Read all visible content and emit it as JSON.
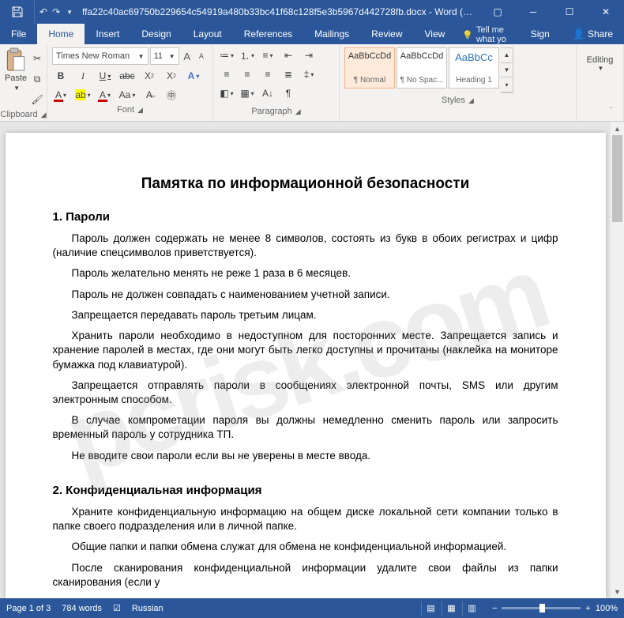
{
  "titlebar": {
    "filename": "ffa22c40ac69750b229654c54919a480b33bc41f68c128f5e3b5967d442728fb.docx - Word (Pro..."
  },
  "tabs": {
    "file": "File",
    "home": "Home",
    "insert": "Insert",
    "design": "Design",
    "layout": "Layout",
    "references": "References",
    "mailings": "Mailings",
    "review": "Review",
    "view": "View",
    "tell": "Tell me what yo",
    "signin": "Sign in",
    "share": "Share"
  },
  "ribbon": {
    "clipboard": {
      "paste": "Paste",
      "label": "Clipboard"
    },
    "font": {
      "name": "Times New Roman",
      "size": "11",
      "label": "Font"
    },
    "paragraph": {
      "label": "Paragraph"
    },
    "styles": {
      "label": "Styles",
      "items": [
        {
          "preview": "AaBbCcDd",
          "name": "¶ Normal"
        },
        {
          "preview": "AaBbCcDd",
          "name": "¶ No Spac..."
        },
        {
          "preview": "AaBbCc",
          "name": "Heading 1"
        }
      ]
    },
    "editing": {
      "label": "Editing"
    }
  },
  "document": {
    "title": "Памятка по информационной безопасности",
    "s1_head": "1. Пароли",
    "s1_p1": "Пароль должен содержать не менее 8 символов, состоять из букв в обоих регистрах и цифр (наличие спецсимволов приветствуется).",
    "s1_p2": "Пароль желательно менять не реже 1 раза в 6 месяцев.",
    "s1_p3": "Пароль не должен совпадать с наименованием учетной записи.",
    "s1_p4": "Запрещается передавать пароль третьим лицам.",
    "s1_p5": "Хранить пароли необходимо в недоступном для посторонних месте. Запрещается запись и хранение паролей в местах, где они могут быть легко доступны и прочитаны (наклейка на мониторе бумажка под клавиатурой).",
    "s1_p6": "Запрещается отправлять пароли в сообщениях электронной почты, SMS или другим электронным способом.",
    "s1_p7": "В случае компрометации пароля вы должны немедленно сменить пароль или запросить временный пароль у сотрудника ТП.",
    "s1_p8": "Не вводите свои пароли если вы не уверены в месте ввода.",
    "s2_head": "2. Конфиденциальная информация",
    "s2_p1": "Храните конфиденциальную информацию на общем диске локальной сети компании только в папке своего подразделения или в личной папке.",
    "s2_p2": "Общие папки и папки обмена служат для обмена не конфиденциальной информацией.",
    "s2_p3": "После сканирования конфиденциальной информации удалите свои файлы из папки сканирования (если у"
  },
  "status": {
    "page": "Page 1 of 3",
    "words": "784 words",
    "lang": "Russian",
    "zoom": "100%"
  },
  "watermark": "pcrisk.com"
}
